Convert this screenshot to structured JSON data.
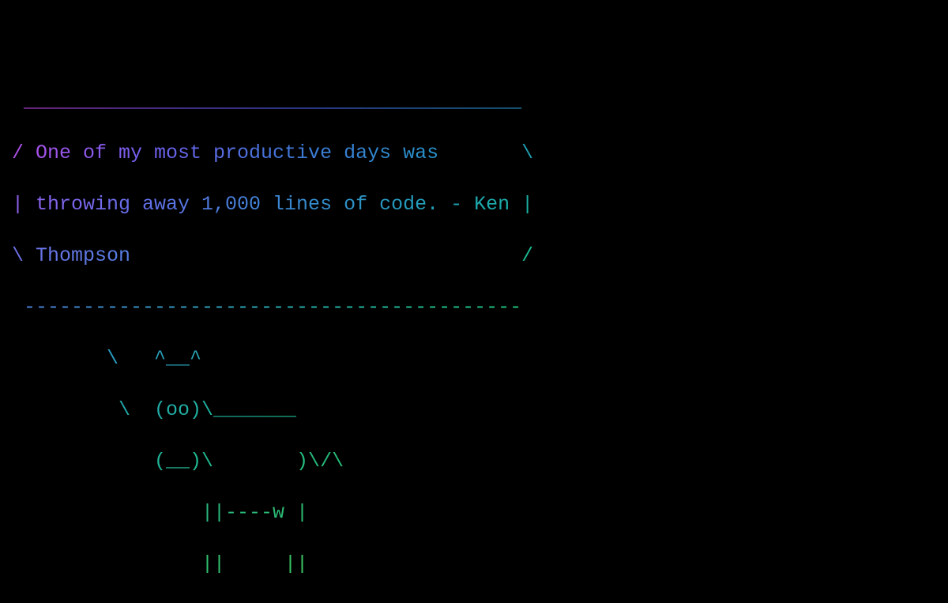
{
  "cowsay": {
    "quote_line1": "One of my most productive days was",
    "quote_line2": "throwing away 1,000 lines of code. - Ken",
    "quote_line3": "Thompson",
    "author": "Ken Thompson",
    "lines": {
      "top": " __________________________________________",
      "l1": "/ One of my most productive days was       \\",
      "l2": "| throwing away 1,000 lines of code. - Ken |",
      "l3": "\\ Thompson                                 /",
      "bottom": " ------------------------------------------",
      "cow1": "        \\   ^__^",
      "cow2": "         \\  (oo)\\_______",
      "cow3": "            (__)\\       )\\/\\",
      "cow4": "                ||----w |",
      "cow5": "                ||     ||"
    }
  }
}
